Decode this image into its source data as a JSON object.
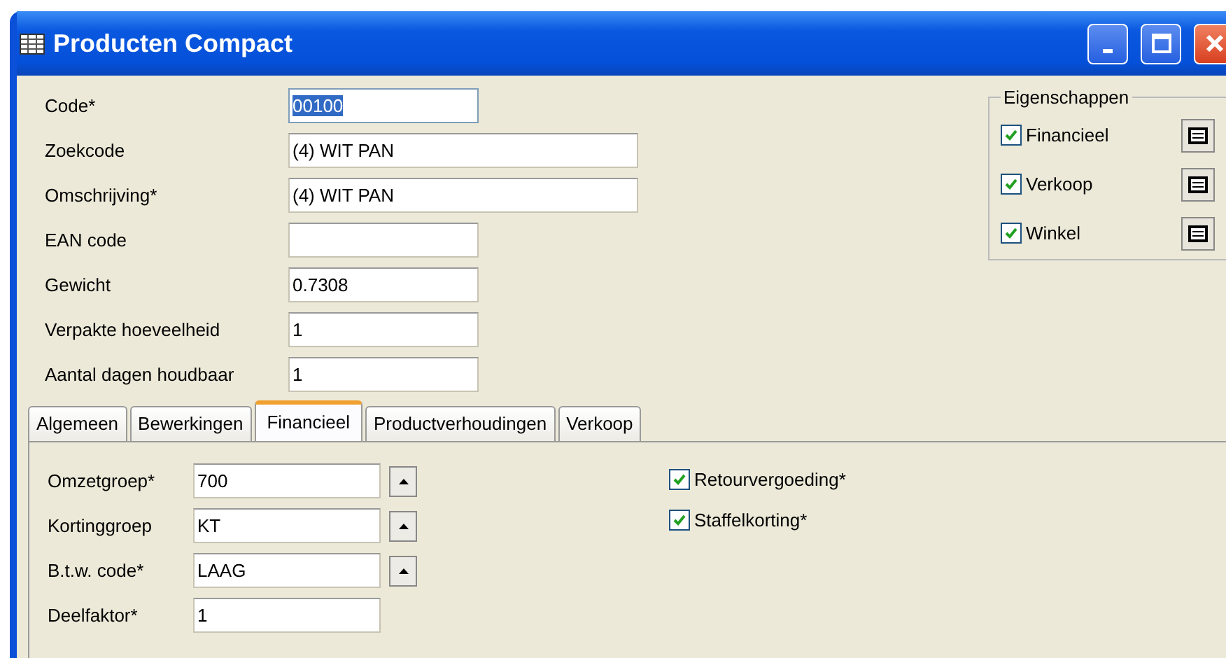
{
  "window": {
    "title": "Producten Compact"
  },
  "fields": [
    {
      "label": "Code*",
      "value": "00100",
      "kind": "short",
      "highlighted": true
    },
    {
      "label": "Zoekcode",
      "value": "(4)  WIT PAN",
      "kind": "wide",
      "highlighted": false
    },
    {
      "label": "Omschrijving*",
      "value": "(4)  WIT PAN",
      "kind": "wide",
      "highlighted": false
    },
    {
      "label": "EAN code",
      "kind": "short",
      "highlighted": false
    },
    {
      "label": "Gewicht",
      "value": "0.7308",
      "kind": "short",
      "highlighted": false
    },
    {
      "label": "Verpakte hoeveelheid",
      "value": "1",
      "kind": "short",
      "highlighted": false
    },
    {
      "label": "Aantal dagen houdbaar",
      "value": "1",
      "kind": "short",
      "highlighted": false
    }
  ],
  "properties": {
    "title": "Eigenschappen",
    "items": [
      {
        "label": "Financieel",
        "checked": true
      },
      {
        "label": "Verkoop",
        "checked": true
      },
      {
        "label": "Winkel",
        "checked": true
      }
    ]
  },
  "tabs": [
    {
      "label": "Algemeen",
      "selected": false
    },
    {
      "label": "Bewerkingen",
      "selected": false
    },
    {
      "label": "Financieel",
      "selected": true
    },
    {
      "label": "Productverhoudingen",
      "selected": false
    },
    {
      "label": "Verkoop",
      "selected": false
    }
  ],
  "tab_fields": [
    {
      "label": "Omzetgroep*",
      "value": "700",
      "kind": "lookup"
    },
    {
      "label": "Kortinggroep",
      "value": "KT",
      "kind": "lookup"
    },
    {
      "label": "B.t.w. code*",
      "value": "LAAG",
      "kind": "lookup"
    },
    {
      "label": "Deelfaktor*",
      "value": "1",
      "kind": "text"
    }
  ],
  "tab_checks": [
    {
      "label": "Retourvergoeding*",
      "checked": true
    },
    {
      "label": "Staffelkorting*",
      "checked": true
    }
  ]
}
